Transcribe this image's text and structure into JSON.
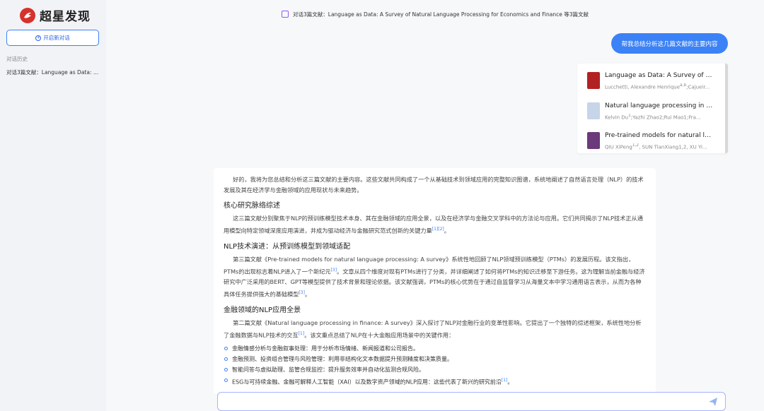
{
  "sidebar": {
    "logo_text": "超星发现",
    "new_chat_label": "开启新对话",
    "history_label": "对话历史",
    "history_items": [
      "对话3篇文献：Language as Data: A ..."
    ]
  },
  "header": {
    "title": "对话3篇文献：Language as Data: A Survey of Natural Language Processing for Economics and Finance 等3篇文献"
  },
  "user_message": "帮我总结分析这几篇文献的主要内容",
  "files": [
    {
      "title": "Language as Data: A Survey of Nat...",
      "authors": "Lucchetti, Alexandre Henrique",
      "authors_sup": "a,b",
      "authors_tail": ";Cajueir...",
      "thumb_color": "#b22222"
    },
    {
      "title": "Natural language processing in fin...",
      "authors": "Kelvin Du",
      "authors_sup": "1",
      "authors_tail": ";Yazhi Zhao2;Rui Mao1;Fra...",
      "thumb_color": "#c8d4e8"
    },
    {
      "title": "Pre-trained models for natural lan...",
      "authors": "QIU XiPeng",
      "authors_sup": "1,2",
      "authors_tail": ", SUN TianXiang1,2, XU Yi...",
      "thumb_color": "#6b3a7a"
    }
  ],
  "answer": {
    "intro": "好的，我将为您总结和分析这三篇文献的主要内容。这些文献共同构成了一个从基础技术到领域应用的完整知识图谱，系统地阐述了自然语言处理（NLP）的技术发展及其在经济学与金融领域的应用现状与未来趋势。",
    "h1": "核心研究脉络综述",
    "p1": "这三篇文献分别聚焦于NLP的预训练模型技术本身、其在金融领域的应用全景，以及在经济学与金融交叉学科中的方法论与应用。它们共同揭示了NLP技术正从通用模型向特定领域深度应用演进，并成为驱动经济与金融研究范式创新的关键力量",
    "p1_cite": "[1][2]",
    "h2": "NLP技术演进：从预训练模型到领域适配",
    "p2a": "第三篇文献《Pre-trained models for natural language processing: A survey》系统性地回顾了NLP领域预训练模型（PTMs）的发展历程。该文指出，PTMs的出现标志着NLP进入了一个新纪元",
    "p2a_cite": "[3]",
    "p2b": "。文章从四个维度对现有PTMs进行了分类，并详细阐述了如何将PTMs的知识迁移至下游任务。这为理解当前金融与经济研究中广泛采用的BERT、GPT等模型提供了技术背景和理论依据。该文献强调，PTMs的核心优势在于通过自监督学习从海量文本中学习通用语言表示，从而为各种具体任务提供强大的基础模型",
    "p2b_cite": "[3]",
    "h3": "金融领域的NLP应用全景",
    "p3a": "第二篇文献《Natural language processing in finance: A survey》深入探讨了NLP对金融行业的变革性影响。它提出了一个独特的综述框架，系统性地分析了金融数据与NLP技术的交互",
    "p3a_cite": "[1]",
    "p3b": "。该文重点总结了NLP在十大金融应用场景中的关键作用：",
    "bullets": [
      "金融情感分析与金融叙事处理：用于分析市场情绪、新闻报道和公司报告。",
      "金融预测、投资组合管理与风险管理：利用非结构化文本数据提升预测精度和决策质量。",
      "智能问答与虚拟助理、监管合规监控：提升服务效率并自动化监测合规风险。",
      "ESG与可持续金融、金融可解释人工智能（XAI）以及数字资产领域的NLP应用：这些代表了新兴的研究前沿"
    ],
    "bullet4_cite": "[1]"
  },
  "colors": {
    "accent": "#3b82f6",
    "logo": "#d6322c"
  }
}
